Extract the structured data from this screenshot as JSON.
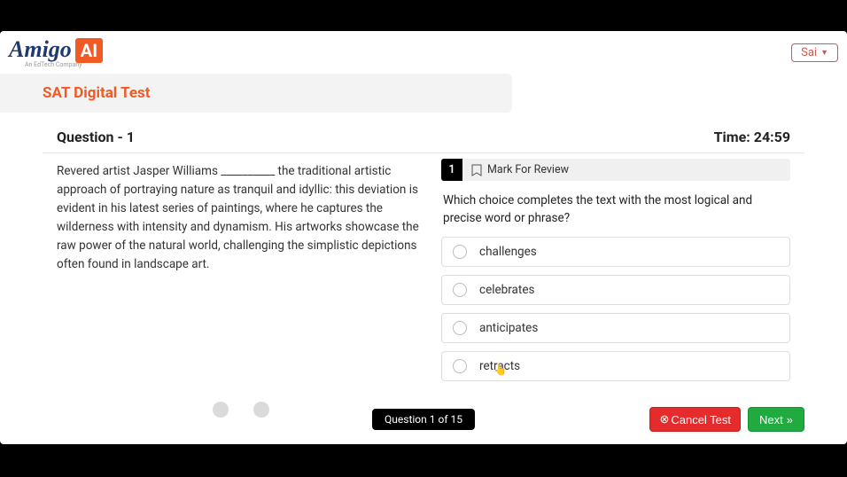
{
  "logo": {
    "brand": "Amigo",
    "ai": "AI",
    "subtitle": "An EdTech Company"
  },
  "user": {
    "name": "Sai"
  },
  "banner": {
    "title": "SAT Digital Test"
  },
  "header": {
    "question_label": "Question - 1",
    "time_label": "Time: 24:59"
  },
  "passage": "Revered artist Jasper Williams __________ the traditional artistic approach of portraying nature as tranquil and idyllic: this deviation is evident in his latest series of paintings, where he captures the wilderness with intensity and dynamism. His artworks showcase the raw power of the natural world, challenging the simplistic depictions often found in landscape art.",
  "question": {
    "number": "1",
    "mark_label": "Mark For Review",
    "prompt": "Which choice completes the text with the most logical and precise word or phrase?",
    "options": [
      "challenges",
      "celebrates",
      "anticipates",
      "retracts"
    ]
  },
  "footer": {
    "progress": "Question 1 of 15",
    "cancel": "Cancel Test",
    "next": "Next"
  }
}
